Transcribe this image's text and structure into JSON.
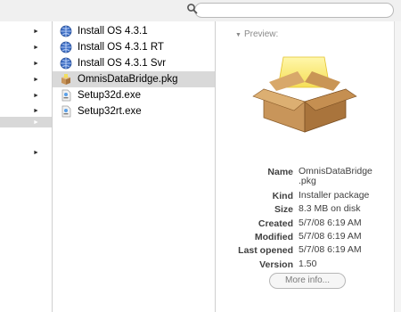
{
  "files": [
    {
      "name": "Install OS 4.3.1",
      "icon": "install-globe-icon"
    },
    {
      "name": "Install OS 4.3.1 RT",
      "icon": "install-globe-icon"
    },
    {
      "name": "Install OS 4.3.1 Svr",
      "icon": "install-globe-icon"
    },
    {
      "name": "OmnisDataBridge.pkg",
      "icon": "package-icon",
      "selected": true
    },
    {
      "name": "Setup32d.exe",
      "icon": "exe-file-icon"
    },
    {
      "name": "Setup32rt.exe",
      "icon": "exe-file-icon"
    }
  ],
  "preview": {
    "label": "Preview:",
    "info": {
      "name_label": "Name",
      "name_value_1": "OmnisDataBridge",
      "name_value_2": ".pkg",
      "kind_label": "Kind",
      "kind_value": "Installer package",
      "size_label": "Size",
      "size_value": "8.3 MB on disk",
      "created_label": "Created",
      "created_value": "5/7/08 6:19 AM",
      "modified_label": "Modified",
      "modified_value": "5/7/08 6:19 AM",
      "last_opened_label": "Last opened",
      "last_opened_value": "5/7/08 6:19 AM",
      "version_label": "Version",
      "version_value": "1.50"
    },
    "more_info_label": "More info..."
  },
  "colors": {
    "selection": "#d9d9d9",
    "package_box": "#c8955a",
    "package_glow": "#f4e04a"
  }
}
